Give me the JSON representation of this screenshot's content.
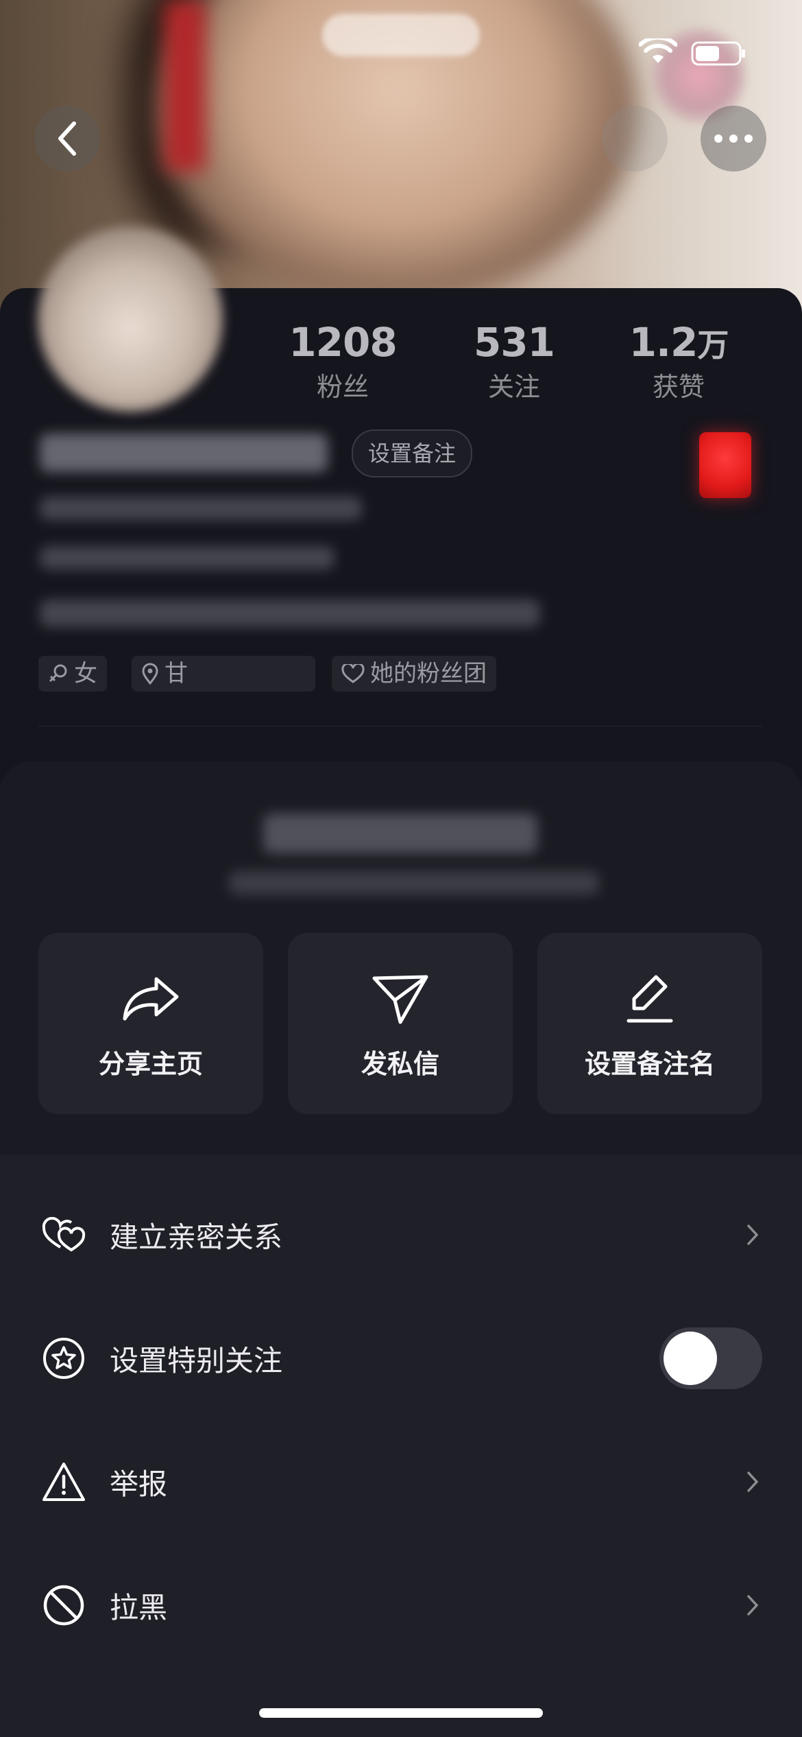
{
  "profile": {
    "stats": [
      {
        "value": "1208",
        "unit": "",
        "label": "粉丝"
      },
      {
        "value": "531",
        "unit": "",
        "label": "关注"
      },
      {
        "value": "1.2",
        "unit": "万",
        "label": "获赞"
      }
    ],
    "remark_chip": "设置备注",
    "tags": {
      "gender": "女",
      "location": "甘",
      "fanclub": "她的粉丝团"
    }
  },
  "actions": [
    {
      "label": "分享主页",
      "icon": "share-icon"
    },
    {
      "label": "发私信",
      "icon": "send-icon"
    },
    {
      "label": "设置备注名",
      "icon": "edit-icon"
    }
  ],
  "menu": [
    {
      "label": "建立亲密关系",
      "icon": "hearts-icon"
    },
    {
      "label": "设置特别关注",
      "icon": "star-icon",
      "toggle": false
    },
    {
      "label": "举报",
      "icon": "warning-icon"
    },
    {
      "label": "拉黑",
      "icon": "block-icon"
    }
  ],
  "colors": {
    "sheet_bg": "#1f1f27",
    "card_bg": "#24242d",
    "page_bg": "#161620"
  }
}
